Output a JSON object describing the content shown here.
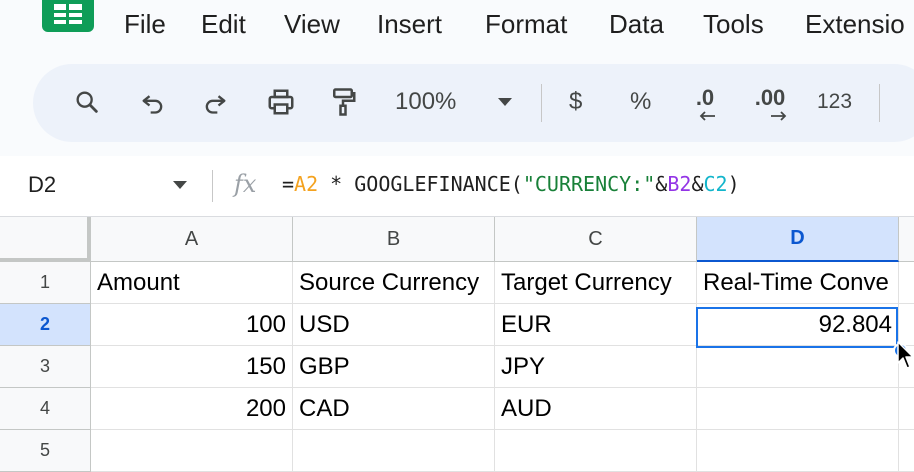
{
  "menu": {
    "items": [
      "File",
      "Edit",
      "View",
      "Insert",
      "Format",
      "Data",
      "Tools",
      "Extensio"
    ]
  },
  "toolbar": {
    "zoom": "100%",
    "currency_label": "$",
    "percent_label": "%",
    "decrease_decimals_label": ".0",
    "increase_decimals_label": ".00",
    "number_format_label": "123",
    "icons": [
      "search-icon",
      "undo-icon",
      "redo-icon",
      "print-icon",
      "paint-format-icon",
      "chevron-down-icon"
    ]
  },
  "formula_bar": {
    "cell_ref": "D2",
    "fx_label": "fx",
    "formula_parts": [
      {
        "text": "=",
        "role": "plain"
      },
      {
        "text": "A2",
        "role": "ref-a2"
      },
      {
        "text": " * GOOGLEFINANCE(",
        "role": "plain"
      },
      {
        "text": "\"CURRENCY:\"",
        "role": "string"
      },
      {
        "text": "&",
        "role": "plain"
      },
      {
        "text": "B2",
        "role": "ref-b2"
      },
      {
        "text": "&",
        "role": "plain"
      },
      {
        "text": "C2",
        "role": "ref-c2"
      },
      {
        "text": ")",
        "role": "plain"
      }
    ],
    "colors": {
      "a2": "#f4a21f",
      "string": "#188038",
      "b2": "#9334e6",
      "c2": "#12b5cb"
    }
  },
  "grid": {
    "columns": [
      "A",
      "B",
      "C",
      "D"
    ],
    "rows": [
      "1",
      "2",
      "3",
      "4",
      "5"
    ],
    "active_cell": "D2",
    "cells": {
      "A1": "Amount",
      "B1": "Source Currency",
      "C1": "Target Currency",
      "D1": "Real-Time Conve",
      "A2": "100",
      "B2": "USD",
      "C2": "EUR",
      "D2": "92.804",
      "A3": "150",
      "B3": "GBP",
      "C3": "JPY",
      "A4": "200",
      "B4": "CAD",
      "C4": "AUD"
    },
    "accent_color": "#1a73e8"
  }
}
